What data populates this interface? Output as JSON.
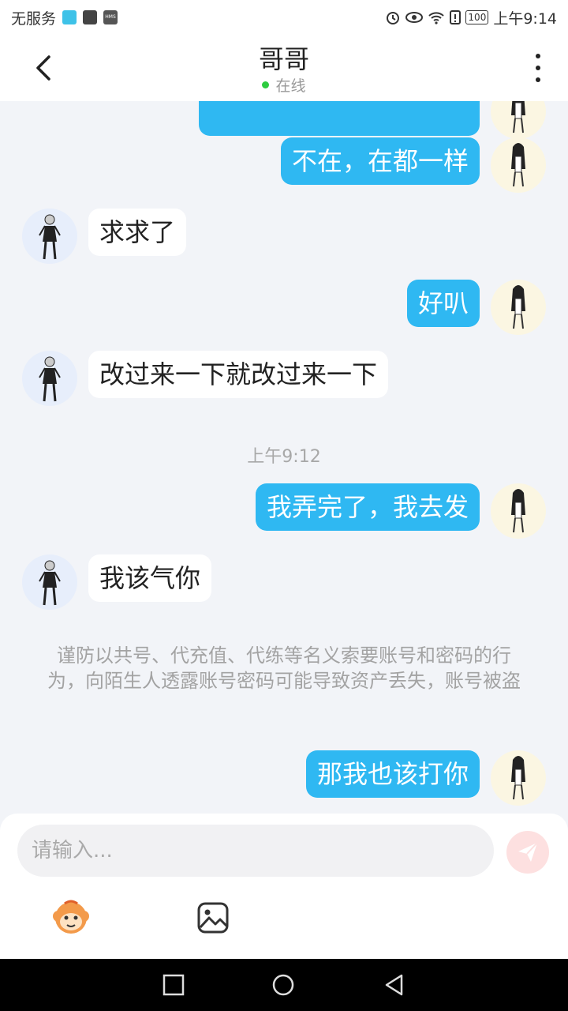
{
  "status_bar": {
    "carrier": "无服务",
    "time": "上午9:14",
    "battery": "100",
    "hms_label": "HMS"
  },
  "header": {
    "title": "哥哥",
    "status": "在线"
  },
  "messages": [
    {
      "side": "me",
      "text": "不在，在都一样"
    },
    {
      "side": "other",
      "text": "求求了"
    },
    {
      "side": "me",
      "text": "好叭"
    },
    {
      "side": "other",
      "text": "改过来一下就改过来一下"
    },
    {
      "side": "me",
      "text": "我弄完了，我去发"
    },
    {
      "side": "other",
      "text": "我该气你"
    },
    {
      "side": "me",
      "text": "那我也该打你"
    }
  ],
  "time_label": "上午9:12",
  "notice": "谨防以共号、代充值、代练等名义索要账号和密码的行为，向陌生人透露账号密码可能导致资产丢失，账号被盗",
  "input": {
    "placeholder": "请输入..."
  },
  "colors": {
    "my_bubble": "#2fb8f2",
    "other_bubble": "#ffffff",
    "background": "#f2f4f8",
    "online_dot": "#2ecc40",
    "send_button": "#fde0e0"
  },
  "icons": [
    "back-arrow-icon",
    "more-vert-icon",
    "emoji-monkey-icon",
    "image-icon",
    "send-icon",
    "nav-square-icon",
    "nav-circle-icon",
    "nav-triangle-icon"
  ]
}
